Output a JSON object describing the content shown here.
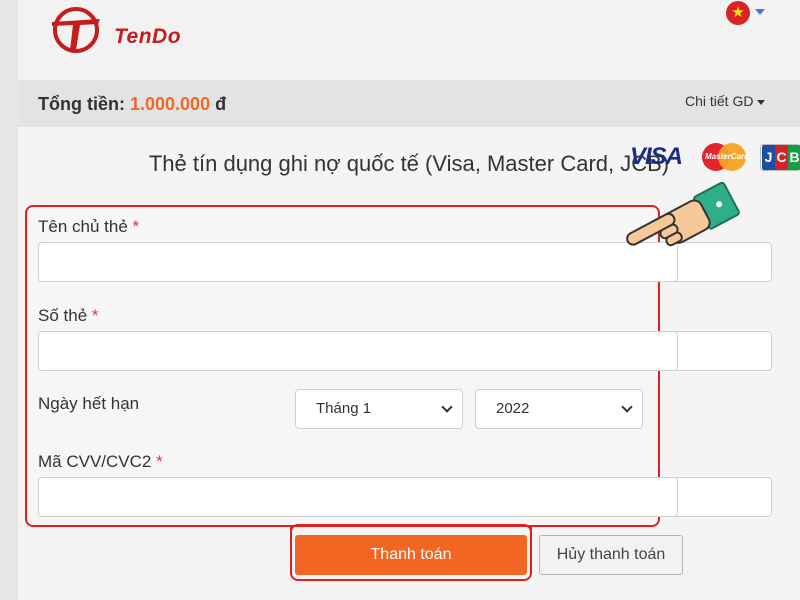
{
  "header": {
    "logo_text": "TenDo",
    "language_flag": "vietnam-flag-icon"
  },
  "summary": {
    "total_label": "Tổng tiền:",
    "total_value": "1.000.000",
    "currency": "đ",
    "detail_link": "Chi tiết GD"
  },
  "card": {
    "title": "Thẻ tín dụng ghi nợ quốc tế (Visa, Master Card, JCB)",
    "brands": [
      "VISA",
      "MasterCard",
      "JCB"
    ]
  },
  "form": {
    "cardholder_label": "Tên chủ thẻ",
    "cardholder_value": "",
    "card_number_label": "Số thẻ",
    "card_number_value": "",
    "expiry_label": "Ngày hết hạn",
    "month_selected": "Tháng 1",
    "year_selected": "2022",
    "cvv_label": "Mã CVV/CVC2",
    "cvv_value": "",
    "required_mark": "*"
  },
  "actions": {
    "pay_label": "Thanh toán",
    "cancel_label": "Hủy thanh toán"
  },
  "colors": {
    "accent": "#f26522",
    "highlight_border": "#e02020",
    "brand_red": "#c41d1d"
  }
}
